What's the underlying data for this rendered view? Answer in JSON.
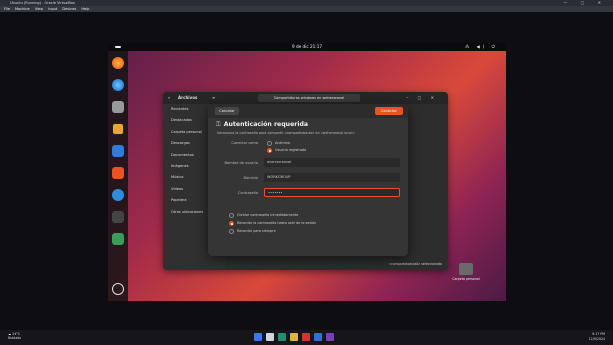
{
  "virtualbox": {
    "title": "Ubuntu (Running) - Oracle VirtualBox",
    "menus": [
      "File",
      "Machine",
      "View",
      "Input",
      "Devices",
      "Help"
    ]
  },
  "ubuntu_topbar": {
    "clock": "9 de dic 21:17"
  },
  "files_window": {
    "app_label": "Archivos",
    "path": "Compartiduras windows en weheraronal",
    "sidebar": [
      "Recientes",
      "Destacados",
      "Carpeta personal",
      "Descargas",
      "Documentos",
      "Imágenes",
      "Música",
      "Vídeos",
      "Papelera",
      "Otras ubicaciones"
    ],
    "status": "«compartidoaulaA» seleccionado"
  },
  "auth_dialog": {
    "cancel_label": "Cancelar",
    "connect_label": "Conectar",
    "title": "Autenticación requerida",
    "key_icon": "key-icon",
    "description": "Introduzca la contraseña para compartir «compartidoaula» en «weheraronal.local»:",
    "connect_as_label": "Conectar como",
    "connect_as_options": [
      "Anónimo",
      "Usuario registrado"
    ],
    "connect_as_selected": "Usuario registrado",
    "username_label": "Nombre de usuario",
    "username_value": "evercarranzal",
    "domain_label": "Dominio",
    "domain_value": "WORKGROUP",
    "password_label": "Contraseña",
    "password_value": "•••••••",
    "remember_options": [
      "Olvidar contraseña inmediatamente",
      "Recordar la contraseña hasta salir de la sesión",
      "Recordar para siempre"
    ],
    "remember_selected": "Recordar la contraseña hasta salir de la sesión"
  },
  "desktop_icon": {
    "label": "Carpeta personal"
  },
  "windows_taskbar": {
    "weather_temp": "24°C",
    "weather_desc": "Nublado",
    "time": "9:17 PM",
    "date": "12/9/2024"
  },
  "colors": {
    "accent": "#e95420",
    "dialog_bg": "#353535"
  }
}
